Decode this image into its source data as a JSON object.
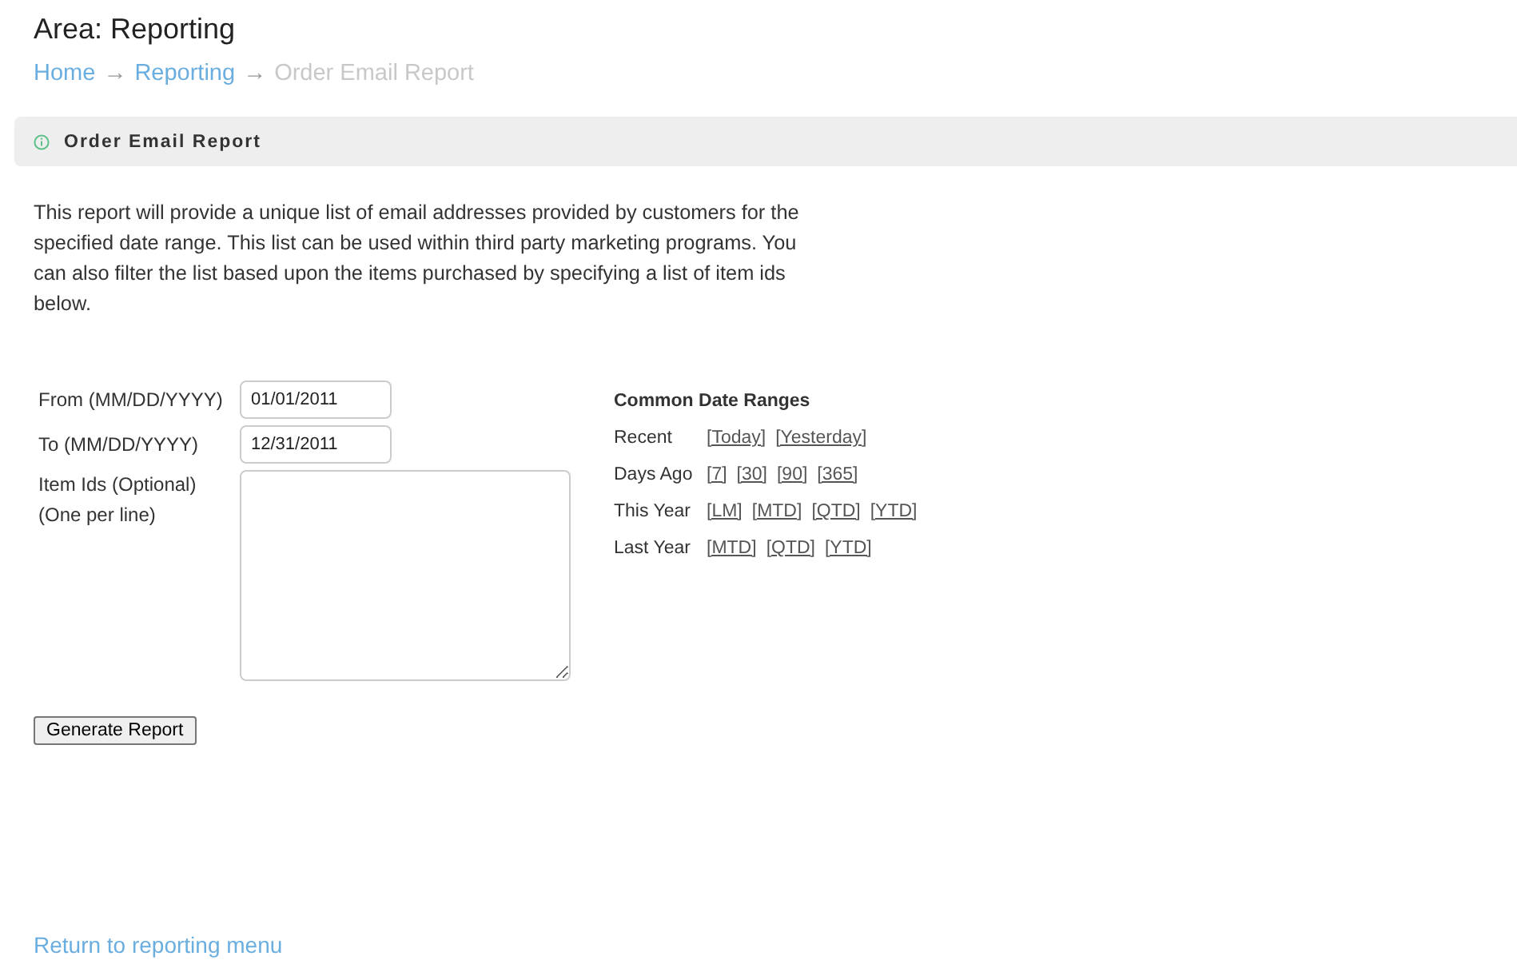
{
  "page": {
    "title": "Area: Reporting"
  },
  "breadcrumb": [
    {
      "label": "Home",
      "kind": "link"
    },
    {
      "label": "→",
      "kind": "separator"
    },
    {
      "label": "Reporting",
      "kind": "link"
    },
    {
      "label": "→",
      "kind": "separator"
    },
    {
      "label": "Order Email Report",
      "kind": "current"
    }
  ],
  "panel": {
    "title": "Order Email Report"
  },
  "description": "This report will provide a unique list of email addresses provided by customers for the specified date range. This list can be used within third party marketing programs. You can also filter the list based upon the items purchased by specifying a list of item ids below.",
  "form": {
    "fields": [
      {
        "label": "From (MM/DD/YYYY)",
        "kind": "text",
        "value": "01/01/2011"
      },
      {
        "label": "To (MM/DD/YYYY)",
        "kind": "text",
        "value": "12/31/2011"
      },
      {
        "label": "Item Ids (Optional)",
        "sublabel": "(One per line)",
        "kind": "textarea"
      }
    ],
    "submit": "Generate Report"
  },
  "date_ranges": {
    "title": "Common Date Ranges",
    "rows": [
      {
        "label": "Recent",
        "links": [
          "[Today]",
          "[Yesterday]"
        ]
      },
      {
        "label": "Days Ago",
        "links": [
          "[7]",
          "[30]",
          "[90]",
          "[365]"
        ]
      },
      {
        "label": "This Year",
        "links": [
          "[LM]",
          "[MTD]",
          "[QTD]",
          "[YTD]"
        ]
      },
      {
        "label": "Last Year",
        "links": [
          "[MTD]",
          "[QTD]",
          "[YTD]"
        ]
      }
    ]
  },
  "footer_link": "Return to reporting menu"
}
